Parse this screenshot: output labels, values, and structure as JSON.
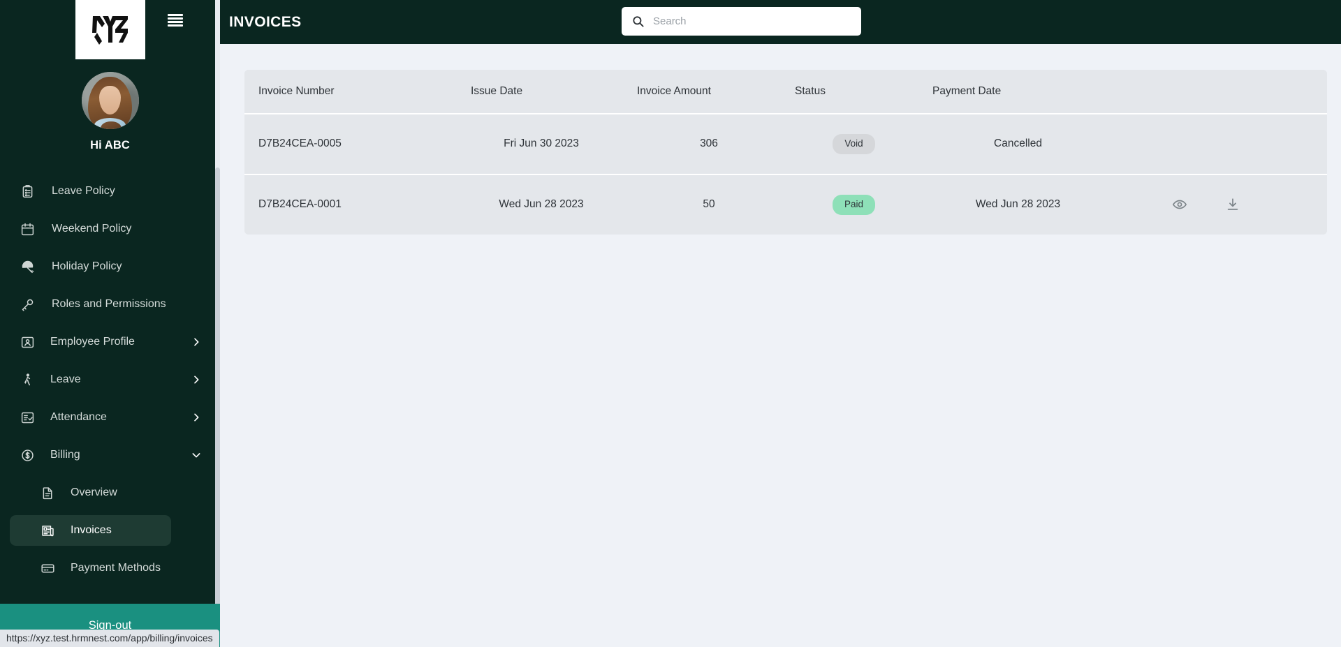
{
  "brand": {
    "logo_text": "XYZ",
    "colors": {
      "sidebar_bg": "#0a2620",
      "signout_bg": "#1a9080",
      "content_bg": "#eff2f7",
      "row_bg": "#e4e7eb",
      "badge_paid": "#8ee0b8",
      "badge_void": "#d5d7da"
    }
  },
  "user": {
    "greeting": "Hi ABC"
  },
  "header": {
    "title": "INVOICES",
    "menu_icon": "hamburger-icon"
  },
  "search": {
    "placeholder": "Search",
    "value": "",
    "icon": "search-icon"
  },
  "sidebar": {
    "items": [
      {
        "label": "Leave Policy",
        "icon": "clipboard-list-icon",
        "level": 0,
        "expandable": false,
        "active": false
      },
      {
        "label": "Weekend Policy",
        "icon": "calendar-icon",
        "level": 0,
        "expandable": false,
        "active": false
      },
      {
        "label": "Holiday Policy",
        "icon": "beach-umbrella-icon",
        "level": 0,
        "expandable": false,
        "active": false
      },
      {
        "label": "Roles and Permissions",
        "icon": "key-icon",
        "level": 0,
        "expandable": false,
        "active": false
      },
      {
        "label": "Employee Profile",
        "icon": "id-badge-icon",
        "level": 1,
        "expandable": true,
        "chevron": "chevron-right-icon",
        "active": false
      },
      {
        "label": "Leave",
        "icon": "walking-person-icon",
        "level": 1,
        "expandable": true,
        "chevron": "chevron-right-icon",
        "active": false
      },
      {
        "label": "Attendance",
        "icon": "checklist-icon",
        "level": 1,
        "expandable": true,
        "chevron": "chevron-right-icon",
        "active": false
      },
      {
        "label": "Billing",
        "icon": "dollar-circle-icon",
        "level": 1,
        "expandable": true,
        "chevron": "chevron-down-icon",
        "active": false
      },
      {
        "label": "Overview",
        "icon": "document-icon",
        "level": 2,
        "expandable": false,
        "active": false
      },
      {
        "label": "Invoices",
        "icon": "newspaper-icon",
        "level": 2,
        "expandable": false,
        "active": true
      },
      {
        "label": "Payment Methods",
        "icon": "credit-card-icon",
        "level": 2,
        "expandable": false,
        "active": false
      }
    ],
    "signout_label": "Sign-out"
  },
  "table": {
    "columns": [
      "Invoice Number",
      "Issue Date",
      "Invoice Amount",
      "Status",
      "Payment Date",
      ""
    ],
    "rows": [
      {
        "invoice_number": "D7B24CEA-0005",
        "issue_date": "Fri Jun 30 2023",
        "invoice_amount": "306",
        "status": "Void",
        "status_kind": "void",
        "payment_date": "Cancelled",
        "has_actions": false
      },
      {
        "invoice_number": "D7B24CEA-0001",
        "issue_date": "Wed Jun 28 2023",
        "invoice_amount": "50",
        "status": "Paid",
        "status_kind": "paid",
        "payment_date": "Wed Jun 28 2023",
        "has_actions": true,
        "actions": [
          {
            "name": "view-invoice",
            "icon": "eye-icon"
          },
          {
            "name": "download-invoice",
            "icon": "download-icon"
          }
        ]
      }
    ]
  },
  "status_bar": {
    "url": "https://xyz.test.hrmnest.com/app/billing/invoices"
  }
}
